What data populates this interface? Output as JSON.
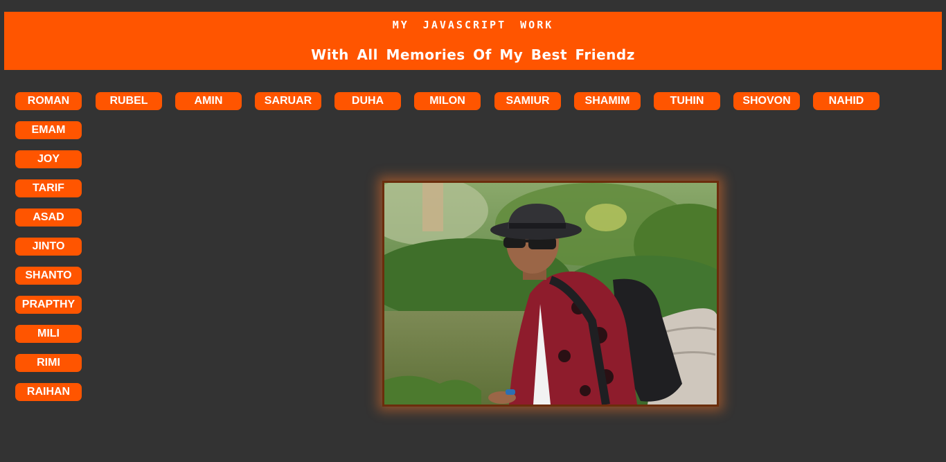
{
  "header": {
    "title": "MY JAVASCRIPT WORK",
    "subtitle": "With All Memories Of My Best Friendz"
  },
  "friends_row": [
    "ROMAN",
    "RUBEL",
    "AMIN",
    "SARUAR",
    "DUHA",
    "MILON",
    "SAMIUR",
    "SHAMIM",
    "TUHIN",
    "SHOVON",
    "NAHID"
  ],
  "friends_column": [
    "EMAM",
    "JOY",
    "TARIF",
    "ASAD",
    "JINTO",
    "SHANTO",
    "PRAPTHY",
    "MILI",
    "RIMI",
    "RAIHAN"
  ],
  "colors": {
    "accent": "#ff5500",
    "background": "#333333",
    "text": "#ffffff"
  },
  "photo": {
    "subject": "man-with-hat-sunglasses-backpack-outdoors"
  }
}
